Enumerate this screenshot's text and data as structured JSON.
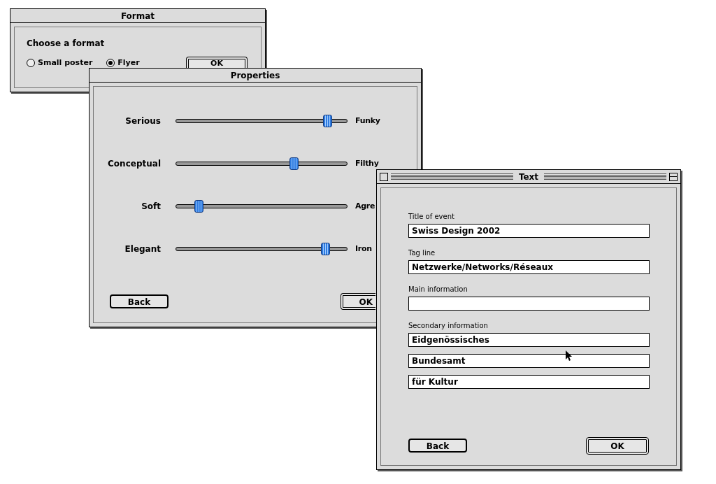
{
  "format_window": {
    "title": "Format",
    "active": false,
    "prompt": "Choose a format",
    "options": [
      {
        "label": "Small poster",
        "selected": false
      },
      {
        "label": "Flyer",
        "selected": true
      }
    ],
    "ok_button": "OK"
  },
  "properties_window": {
    "title": "Properties",
    "active": false,
    "sliders": [
      {
        "left": "Serious",
        "right": "Funky",
        "level": 0.86
      },
      {
        "left": "Conceptual",
        "right": "Filthy",
        "level": 0.67
      },
      {
        "left": "Soft",
        "right": "Agre",
        "level": 0.13
      },
      {
        "left": "Elegant",
        "right": "Iron",
        "level": 0.85
      }
    ],
    "back_button": "Back",
    "ok_button": "OK"
  },
  "text_window": {
    "title": "Text",
    "active": true,
    "groups": [
      {
        "label": "Title of event",
        "fields": [
          {
            "kind": "text",
            "value": "Swiss Design 2002"
          }
        ]
      },
      {
        "label": "Tag line",
        "fields": [
          {
            "kind": "text",
            "value": "Netzwerke/Networks/Réseaux"
          }
        ]
      },
      {
        "label": "Main information",
        "fields": [
          {
            "kind": "empty"
          }
        ]
      },
      {
        "label": "Secondary information",
        "fields": [
          {
            "kind": "text",
            "value": "Eidgenössisches"
          },
          {
            "kind": "text",
            "value": "Bundesamt"
          },
          {
            "kind": "text",
            "value": "für Kultur"
          }
        ]
      }
    ],
    "back_button": "Back",
    "ok_button": "OK"
  }
}
